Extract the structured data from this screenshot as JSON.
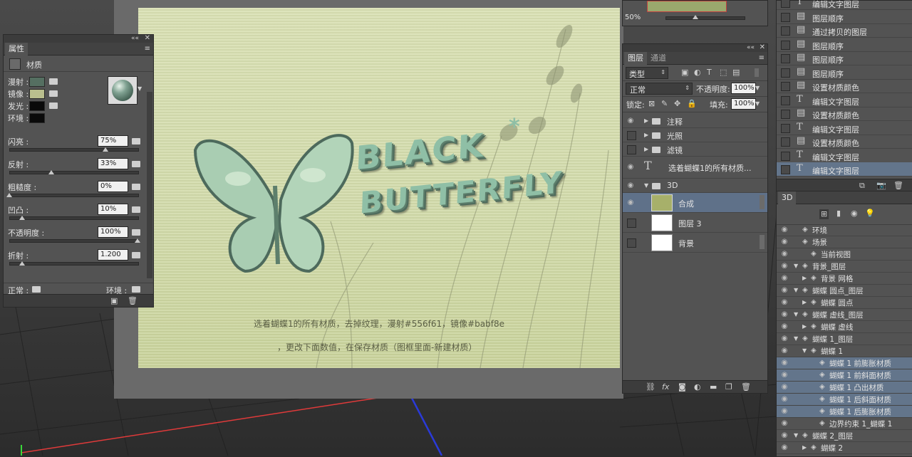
{
  "properties_panel": {
    "tab": "属性",
    "section": "材质",
    "swatches": [
      {
        "label": "漫射 :",
        "color": "#556f61"
      },
      {
        "label": "镜像 :",
        "color": "#babf8e"
      },
      {
        "label": "发光 :",
        "color": "#0a0a0a"
      },
      {
        "label": "环境 :",
        "color": "#0a0a0a"
      }
    ],
    "params": [
      {
        "label": "闪亮 :",
        "value": "75%",
        "thumb": 0.75
      },
      {
        "label": "反射 :",
        "value": "33%",
        "thumb": 0.33
      },
      {
        "label": "粗糙度 :",
        "value": "0%",
        "thumb": 0.0
      },
      {
        "label": "凹凸 :",
        "value": "10%",
        "thumb": 0.1
      },
      {
        "label": "不透明度 :",
        "value": "100%",
        "thumb": 1.0
      },
      {
        "label": "折射 :",
        "value": "1.200",
        "thumb": 0.1
      }
    ],
    "normal_label": "正常 :",
    "env_label": "环境 :"
  },
  "canvas": {
    "title_line1": "BLACK",
    "title_line2": "BUTTERFLY",
    "star": "*",
    "note1": "选着蝴蝶1的所有材质，去掉纹理，漫射#556f61，镜像#babf8e",
    "note2": "，更改下面数值，在保存材质（图框里面-新建材质）"
  },
  "navigator": {
    "zoom": "50%"
  },
  "layers_panel": {
    "tabs": [
      "图层",
      "通道"
    ],
    "filter_label": "类型",
    "blend_mode": "正常",
    "opacity_label": "不透明度:",
    "opacity_value": "100%",
    "lock_label": "锁定:",
    "fill_label": "填充:",
    "fill_value": "100%",
    "layers": [
      {
        "name": "注释",
        "kind": "folder",
        "visible": true
      },
      {
        "name": "光照",
        "kind": "folder",
        "visible": false
      },
      {
        "name": "滤镜",
        "kind": "folder",
        "visible": false
      },
      {
        "name": "选着蝴蝶1的所有材质...",
        "kind": "text",
        "visible": true
      },
      {
        "name": "3D",
        "kind": "folder-open",
        "visible": true
      },
      {
        "name": "合成",
        "kind": "thumb",
        "visible": true,
        "selected": true
      },
      {
        "name": "图层 3",
        "kind": "white",
        "visible": false
      },
      {
        "name": "背景",
        "kind": "white",
        "visible": false
      }
    ]
  },
  "history_panel": {
    "items": [
      {
        "name": "编辑文字图层",
        "icon": "T"
      },
      {
        "name": "图层顺序",
        "icon": "doc"
      },
      {
        "name": "通过拷贝的图层",
        "icon": "doc"
      },
      {
        "name": "图层顺序",
        "icon": "doc"
      },
      {
        "name": "图层顺序",
        "icon": "doc"
      },
      {
        "name": "图层顺序",
        "icon": "doc"
      },
      {
        "name": "设置材质颜色",
        "icon": "doc"
      },
      {
        "name": "编辑文字图层",
        "icon": "T"
      },
      {
        "name": "设置材质颜色",
        "icon": "doc"
      },
      {
        "name": "编辑文字图层",
        "icon": "T"
      },
      {
        "name": "设置材质颜色",
        "icon": "doc"
      },
      {
        "name": "编辑文字图层",
        "icon": "T"
      },
      {
        "name": "编辑文字图层",
        "icon": "T",
        "selected": true
      }
    ]
  },
  "scene_panel": {
    "tab": "3D",
    "items": [
      {
        "name": "环境",
        "indent": 0,
        "expand": ""
      },
      {
        "name": "场景",
        "indent": 0,
        "expand": ""
      },
      {
        "name": "当前视图",
        "indent": 1,
        "expand": ""
      },
      {
        "name": "背景_图层",
        "indent": 0,
        "expand": "▼"
      },
      {
        "name": "背景 网格",
        "indent": 1,
        "expand": "▶"
      },
      {
        "name": "蝴蝶 圆点_图层",
        "indent": 0,
        "expand": "▼"
      },
      {
        "name": "蝴蝶 圆点",
        "indent": 1,
        "expand": "▶"
      },
      {
        "name": "蝴蝶 虚线_图层",
        "indent": 0,
        "expand": "▼"
      },
      {
        "name": "蝴蝶 虚线",
        "indent": 1,
        "expand": "▶"
      },
      {
        "name": "蝴蝶 1_图层",
        "indent": 0,
        "expand": "▼"
      },
      {
        "name": "蝴蝶 1",
        "indent": 1,
        "expand": "▼"
      },
      {
        "name": "蝴蝶 1 前膨胀材质",
        "indent": 2,
        "expand": "",
        "selected": true
      },
      {
        "name": "蝴蝶 1 前斜面材质",
        "indent": 2,
        "expand": "",
        "selected": true
      },
      {
        "name": "蝴蝶 1 凸出材质",
        "indent": 2,
        "expand": "",
        "selected": true
      },
      {
        "name": "蝴蝶 1 后斜面材质",
        "indent": 2,
        "expand": "",
        "selected": true
      },
      {
        "name": "蝴蝶 1 后膨胀材质",
        "indent": 2,
        "expand": "",
        "selected": true
      },
      {
        "name": "边界约束 1_蝴蝶 1",
        "indent": 2,
        "expand": ""
      },
      {
        "name": "蝴蝶 2_图层",
        "indent": 0,
        "expand": "▼"
      },
      {
        "name": "蝴蝶 2",
        "indent": 1,
        "expand": "▶"
      }
    ]
  }
}
